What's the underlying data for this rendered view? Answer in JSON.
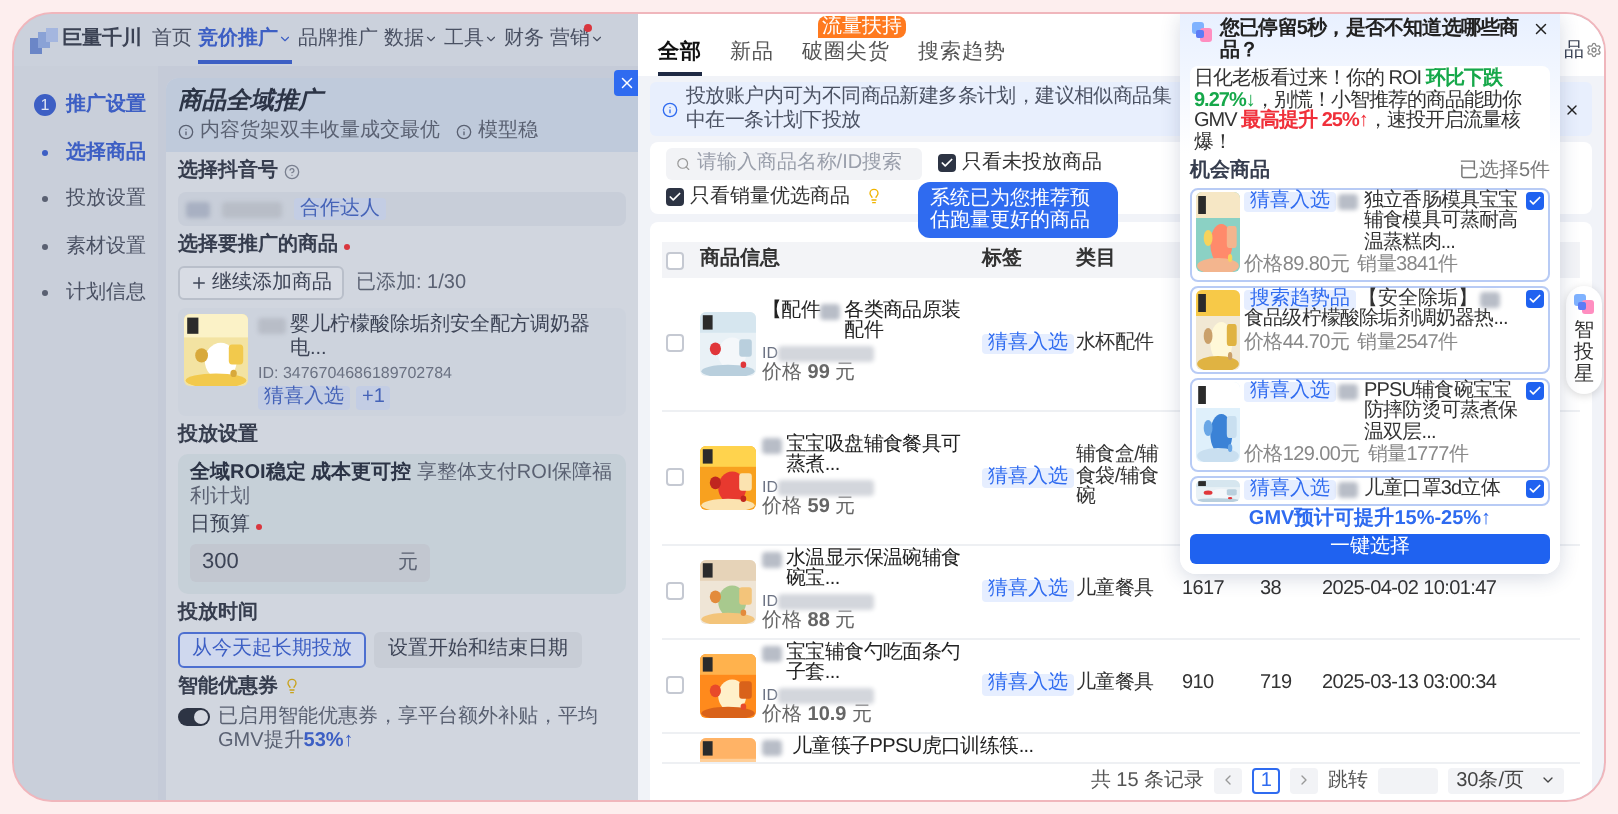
{
  "nav": {
    "logo": "巨量千川",
    "items": [
      {
        "label": "首页",
        "selected": false,
        "dropdown": false,
        "dot": false
      },
      {
        "label": "竞价推广",
        "selected": true,
        "dropdown": true,
        "dot": false
      },
      {
        "label": "品牌推广",
        "selected": false,
        "dropdown": false,
        "dot": false
      },
      {
        "label": "数据",
        "selected": false,
        "dropdown": true,
        "dot": false
      },
      {
        "label": "工具",
        "selected": false,
        "dropdown": true,
        "dot": false
      },
      {
        "label": "财务",
        "selected": false,
        "dropdown": false,
        "dot": false
      },
      {
        "label": "营销",
        "selected": false,
        "dropdown": true,
        "dot": true
      }
    ]
  },
  "steps": [
    {
      "kind": "section",
      "number": "1",
      "label": "推广设置",
      "selected": true
    },
    {
      "kind": "sub",
      "label": "选择商品",
      "selected": true
    },
    {
      "kind": "sub",
      "label": "投放设置",
      "selected": false
    },
    {
      "kind": "sub",
      "label": "素材设置",
      "selected": false
    },
    {
      "kind": "sub",
      "label": "计划信息",
      "selected": false
    }
  ],
  "form": {
    "title": "商品全域推广",
    "notes": [
      "内容货架双丰收量成交最优",
      "模型稳"
    ],
    "account_label": "选择抖音号",
    "account_tag": "合作达人",
    "product_label": "选择要推广的商品",
    "product_required": true,
    "add_button": "继续添加商品",
    "added_count": "已添加: 1/30",
    "product": {
      "title": "婴儿柠檬酸除垢剂安全配方调奶器电...",
      "id": "ID: 3476704686189702784",
      "tags": [
        "猜喜入选",
        "+1"
      ]
    },
    "section_title": "投放设置",
    "roi": {
      "title": "全域ROI稳定 成本更可控",
      "note": "享整体支付ROI保障福利计划"
    },
    "budget_label": "日预算",
    "budget_required": true,
    "budget_value": "300",
    "budget_unit": "元",
    "schedule_label": "投放时间",
    "schedule_options": [
      {
        "label": "从今天起长期投放",
        "selected": true
      },
      {
        "label": "设置开始和结束日期",
        "selected": false
      }
    ],
    "coupon_label": "智能优惠券",
    "coupon": {
      "on": true,
      "text": "已启用智能优惠券，享平台额外补贴，平均GMV提升",
      "gain": "53%↑"
    }
  },
  "drawer": {
    "tabs": [
      {
        "label": "全部",
        "selected": true
      },
      {
        "label": "新品",
        "selected": false
      },
      {
        "label": "破圈尖货",
        "selected": false,
        "badge": "流量扶持"
      },
      {
        "label": "搜索趋势",
        "selected": false
      }
    ],
    "corner_text": "品",
    "notice": "投放账户内可为不同商品新建多条计划，建议相似商品集中在一条计划下投放",
    "search_placeholder": "请输入商品名称/ID搜索",
    "filters": [
      {
        "label": "只看未投放商品",
        "checked": true
      },
      {
        "label": "只看销量优选商品",
        "checked": true
      }
    ],
    "tooltip": "系统已为您推荐预估跑量更好的商品",
    "table": {
      "select_all": false,
      "columns": [
        "商品信息",
        "标签",
        "类目"
      ],
      "rows": [
        {
          "kind": "full",
          "selected": false,
          "lead": "【配件",
          "title": "各类商品原装配件",
          "id_label": "ID",
          "price": "价格 **99** 元",
          "tag": "猜喜入选",
          "category": "水杯配件"
        },
        {
          "kind": "full",
          "selected": false,
          "title": "宝宝吸盘辅食餐具可蒸煮...",
          "id_label": "ID",
          "price": "价格 **59** 元",
          "tag": "猜喜入选",
          "category": "辅食盒/辅食袋/辅食碗"
        },
        {
          "kind": "full",
          "selected": false,
          "title": "水温显示保温碗辅食碗宝...",
          "id_label": "ID",
          "price": "价格 **88** 元",
          "tag": "猜喜入选",
          "category": "儿童餐具",
          "column_4": "1617",
          "column_5": "38",
          "column_6": "2025-04-02 10:01:47"
        },
        {
          "kind": "full",
          "selected": false,
          "title": "宝宝辅食勺吃面条勺子套...",
          "id_label": "ID",
          "price": "价格 **10.9** 元",
          "tag": "猜喜入选",
          "category": "儿童餐具",
          "column_4": "910",
          "column_5": "719",
          "column_6": "2025-03-13 03:00:34"
        },
        {
          "kind": "cut",
          "title": "儿童筷子PPSU虎口训练筷..."
        }
      ]
    },
    "pagination": {
      "total": "共 15 条记录",
      "page": "1",
      "jump_label": "跳转",
      "page_size": "30条/页"
    }
  },
  "popup": {
    "title": "您已停留5秒，是否不知道选哪些商品？",
    "message": [
      {
        "text": "日化老板看过来！你的 ROI "
      },
      {
        "text": "环比下跌 9.27%↓",
        "color": "#16a84a"
      },
      {
        "text": "，别慌！小智推荐的商品能助你 GMV "
      },
      {
        "text": "最高提升 25%↑",
        "color": "#f0303a"
      },
      {
        "text": "，速投开启流量核爆！"
      }
    ],
    "list_title": "机会商品",
    "selected_count": "已选择5件",
    "items": [
      {
        "tag": "猜喜入选",
        "title": "独立香肠模具宝宝辅食模具可蒸耐高温蒸糕肉...",
        "price": "价格89.80元",
        "sales": "销量3841件",
        "checked": true
      },
      {
        "tag": "搜索趋势品",
        "lead": "【安全除垢】",
        "title": "食品级柠檬酸除垢剂调奶器热...",
        "price": "价格44.70元",
        "sales": "销量2547件",
        "checked": true
      },
      {
        "tag": "猜喜入选",
        "title": "PPSU辅食碗宝宝防摔防烫可蒸煮保温双层...",
        "price": "价格129.00元",
        "sales": "销量1777件",
        "checked": true
      },
      {
        "tag": "猜喜入选",
        "title": "儿童口罩3d立体",
        "checked": true
      }
    ],
    "forecast": "GMV预计可提升15%-25%↑",
    "action": "一键选择"
  },
  "assistant": {
    "label": "智投星"
  }
}
